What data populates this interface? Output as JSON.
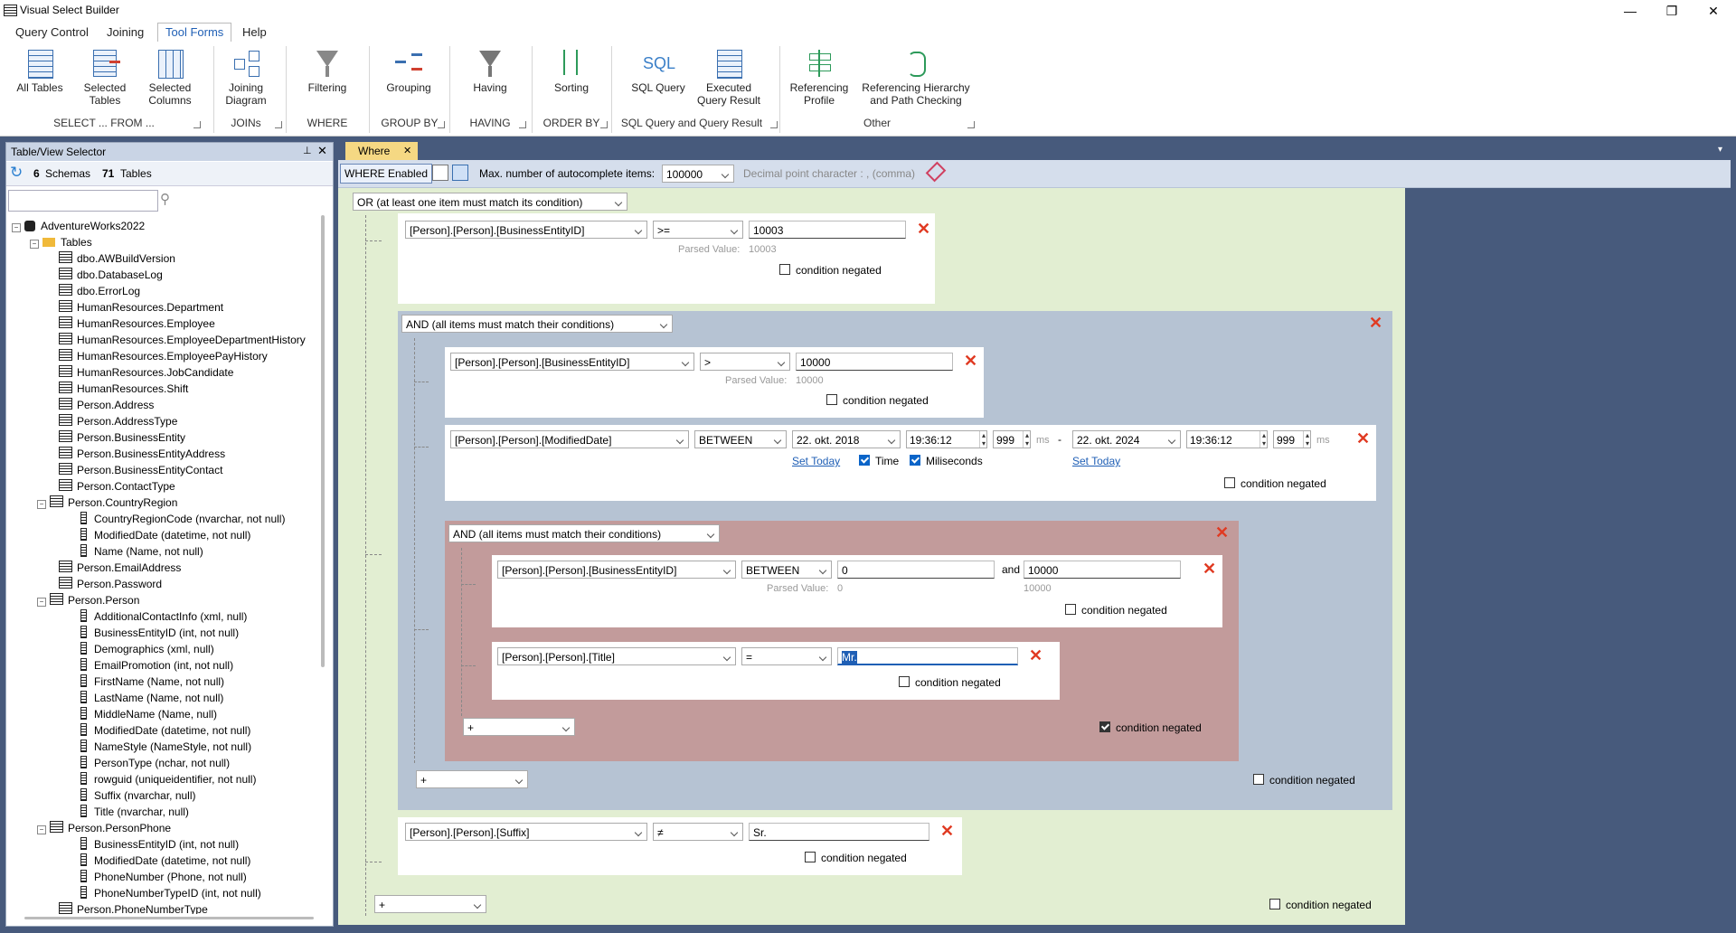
{
  "window": {
    "title": "Visual Select Builder"
  },
  "menu": {
    "tabs": [
      "Query Control",
      "Joining",
      "Tool Forms",
      "Help"
    ],
    "active": "Tool Forms"
  },
  "ribbon": {
    "buttons": {
      "all_tables": "All Tables",
      "selected_tables": "Selected Tables",
      "selected_columns": "Selected Columns",
      "joining_diagram": "Joining Diagram",
      "filtering": "Filtering",
      "grouping": "Grouping",
      "having": "Having",
      "sorting": "Sorting",
      "sql_query": "SQL Query",
      "executed_query_result": "Executed Query Result",
      "referencing_profile": "Referencing Profile",
      "referencing_hierarchy": "Referencing Hierarchy and Path Checking"
    },
    "groups": {
      "select_from": "SELECT ... FROM ...",
      "joins": "JOINs",
      "where": "WHERE",
      "group_by": "GROUP BY",
      "having": "HAVING",
      "order_by": "ORDER BY",
      "sql_query": "SQL Query and Query Result",
      "other": "Other"
    },
    "sql_icon_text": "SQL"
  },
  "selector": {
    "title": "Table/View Selector",
    "schemas_count": "6",
    "schemas_label": "Schemas",
    "tables_count": "71",
    "tables_label": "Tables",
    "search_value": "",
    "database": "AdventureWorks2022",
    "tables_folder": "Tables",
    "items": [
      {
        "t": "table",
        "label": "dbo.AWBuildVersion"
      },
      {
        "t": "table",
        "label": "dbo.DatabaseLog"
      },
      {
        "t": "table",
        "label": "dbo.ErrorLog"
      },
      {
        "t": "table",
        "label": "HumanResources.Department"
      },
      {
        "t": "table",
        "label": "HumanResources.Employee"
      },
      {
        "t": "table",
        "label": "HumanResources.EmployeeDepartmentHistory"
      },
      {
        "t": "table",
        "label": "HumanResources.EmployeePayHistory"
      },
      {
        "t": "table",
        "label": "HumanResources.JobCandidate"
      },
      {
        "t": "table",
        "label": "HumanResources.Shift"
      },
      {
        "t": "table",
        "label": "Person.Address"
      },
      {
        "t": "table",
        "label": "Person.AddressType"
      },
      {
        "t": "table",
        "label": "Person.BusinessEntity"
      },
      {
        "t": "table",
        "label": "Person.BusinessEntityAddress"
      },
      {
        "t": "table",
        "label": "Person.BusinessEntityContact"
      },
      {
        "t": "table",
        "label": "Person.ContactType"
      },
      {
        "t": "table-open",
        "label": "Person.CountryRegion"
      },
      {
        "t": "col",
        "label": "CountryRegionCode (nvarchar, not null)"
      },
      {
        "t": "col",
        "label": "ModifiedDate (datetime, not null)"
      },
      {
        "t": "col",
        "label": "Name (Name, not null)"
      },
      {
        "t": "table",
        "label": "Person.EmailAddress"
      },
      {
        "t": "table",
        "label": "Person.Password"
      },
      {
        "t": "table-open",
        "label": "Person.Person"
      },
      {
        "t": "col",
        "label": "AdditionalContactInfo (xml, null)"
      },
      {
        "t": "col",
        "label": "BusinessEntityID (int, not null)"
      },
      {
        "t": "col",
        "label": "Demographics (xml, null)"
      },
      {
        "t": "col",
        "label": "EmailPromotion (int, not null)"
      },
      {
        "t": "col",
        "label": "FirstName (Name, not null)"
      },
      {
        "t": "col",
        "label": "LastName (Name, not null)"
      },
      {
        "t": "col",
        "label": "MiddleName (Name, null)"
      },
      {
        "t": "col",
        "label": "ModifiedDate (datetime, not null)"
      },
      {
        "t": "col",
        "label": "NameStyle (NameStyle, not null)"
      },
      {
        "t": "col",
        "label": "PersonType (nchar, not null)"
      },
      {
        "t": "col",
        "label": "rowguid (uniqueidentifier, not null)"
      },
      {
        "t": "col",
        "label": "Suffix (nvarchar, null)"
      },
      {
        "t": "col",
        "label": "Title (nvarchar, null)"
      },
      {
        "t": "table-open",
        "label": "Person.PersonPhone"
      },
      {
        "t": "col",
        "label": "BusinessEntityID (int, not null)"
      },
      {
        "t": "col",
        "label": "ModifiedDate (datetime, not null)"
      },
      {
        "t": "col",
        "label": "PhoneNumber (Phone, not null)"
      },
      {
        "t": "col",
        "label": "PhoneNumberTypeID (int, not null)"
      },
      {
        "t": "table",
        "label": "Person.PhoneNumberType"
      }
    ]
  },
  "doc": {
    "tab_label": "Where"
  },
  "where_toolbar": {
    "enabled_label": "WHERE Enabled",
    "max_label": "Max. number of autocomplete items:",
    "max_value": "100000",
    "decimal_label": "Decimal point character : ,  (comma)"
  },
  "where": {
    "root_op": "OR (at least one item must match its condition)",
    "c1": {
      "column": "[Person].[Person].[BusinessEntityID]",
      "op": ">=",
      "value": "10003",
      "parsed_label": "Parsed Value:",
      "parsed": "10003",
      "negated_label": "condition negated"
    },
    "g1": {
      "op": "AND (all items must match their conditions)",
      "negated_label": "condition negated",
      "add": "+"
    },
    "c2": {
      "column": "[Person].[Person].[BusinessEntityID]",
      "op": ">",
      "value": "10000",
      "parsed_label": "Parsed Value:",
      "parsed": "10000",
      "negated_label": "condition negated"
    },
    "c3": {
      "column": "[Person].[Person].[ModifiedDate]",
      "op": "BETWEEN",
      "date1": "22. okt. 2018",
      "time1": "19:36:12",
      "ms1": "999",
      "ms_label": "ms",
      "dash": "-",
      "date2": "22. okt. 2024",
      "time2": "19:36:12",
      "ms2": "999",
      "set_today": "Set Today",
      "time_label": "Time",
      "ms_check_label": "Miliseconds",
      "negated_label": "condition negated"
    },
    "g2": {
      "op": "AND (all items must match their conditions)",
      "negated_label": "condition negated",
      "add": "+"
    },
    "c4": {
      "column": "[Person].[Person].[BusinessEntityID]",
      "op": "BETWEEN",
      "value1": "0",
      "and_label": "and",
      "value2": "10000",
      "parsed_label": "Parsed Value:",
      "parsed1": "0",
      "parsed2": "10000",
      "negated_label": "condition negated"
    },
    "c5": {
      "column": "[Person].[Person].[Title]",
      "op": "=",
      "value": "Mr.",
      "negated_label": "condition negated"
    },
    "c6": {
      "column": "[Person].[Person].[Suffix]",
      "op": "≠",
      "value": "Sr.",
      "negated_label": "condition negated"
    },
    "root_add": "+",
    "root_negated_label": "condition negated"
  },
  "colors": {
    "accent": "#1f5fb5",
    "delete": "#e03a22",
    "or_group": "#e2eed2",
    "and_group": "#b6c3d3",
    "negated_group": "#c29b9b",
    "tab": "#f5d883"
  }
}
